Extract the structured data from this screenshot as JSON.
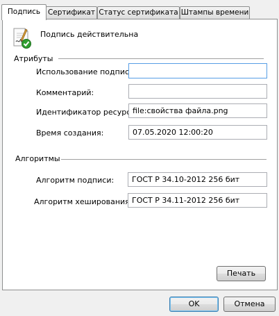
{
  "tabs": [
    {
      "label": "Подпись"
    },
    {
      "label": "Сертификат"
    },
    {
      "label": "Статус сертификата"
    },
    {
      "label": "Штампы времени"
    }
  ],
  "signature": {
    "icon": "signed-document-check-icon",
    "status": "Подпись действительна"
  },
  "attributes": {
    "title": "Атрибуты",
    "fields": [
      {
        "label": "Использование подписи:",
        "value": ""
      },
      {
        "label": "Комментарий:",
        "value": ""
      },
      {
        "label": "Идентификатор ресурса:",
        "value": "file:свойства файла.png"
      },
      {
        "label": "Время создания:",
        "value": "07.05.2020 12:00:20"
      }
    ]
  },
  "algorithms": {
    "title": "Алгоритмы",
    "fields": [
      {
        "label": "Алгоритм подписи:",
        "value": "ГОСТ Р 34.10-2012 256 бит"
      },
      {
        "label": "Алгоритм хеширования:",
        "value": "ГОСТ Р 34.11-2012 256 бит"
      }
    ]
  },
  "buttons": {
    "print": "Печать",
    "ok": "OK",
    "cancel": "Отмена"
  },
  "colors": {
    "accent_focus": "#569de5",
    "check_green": "#2f9e2f"
  }
}
